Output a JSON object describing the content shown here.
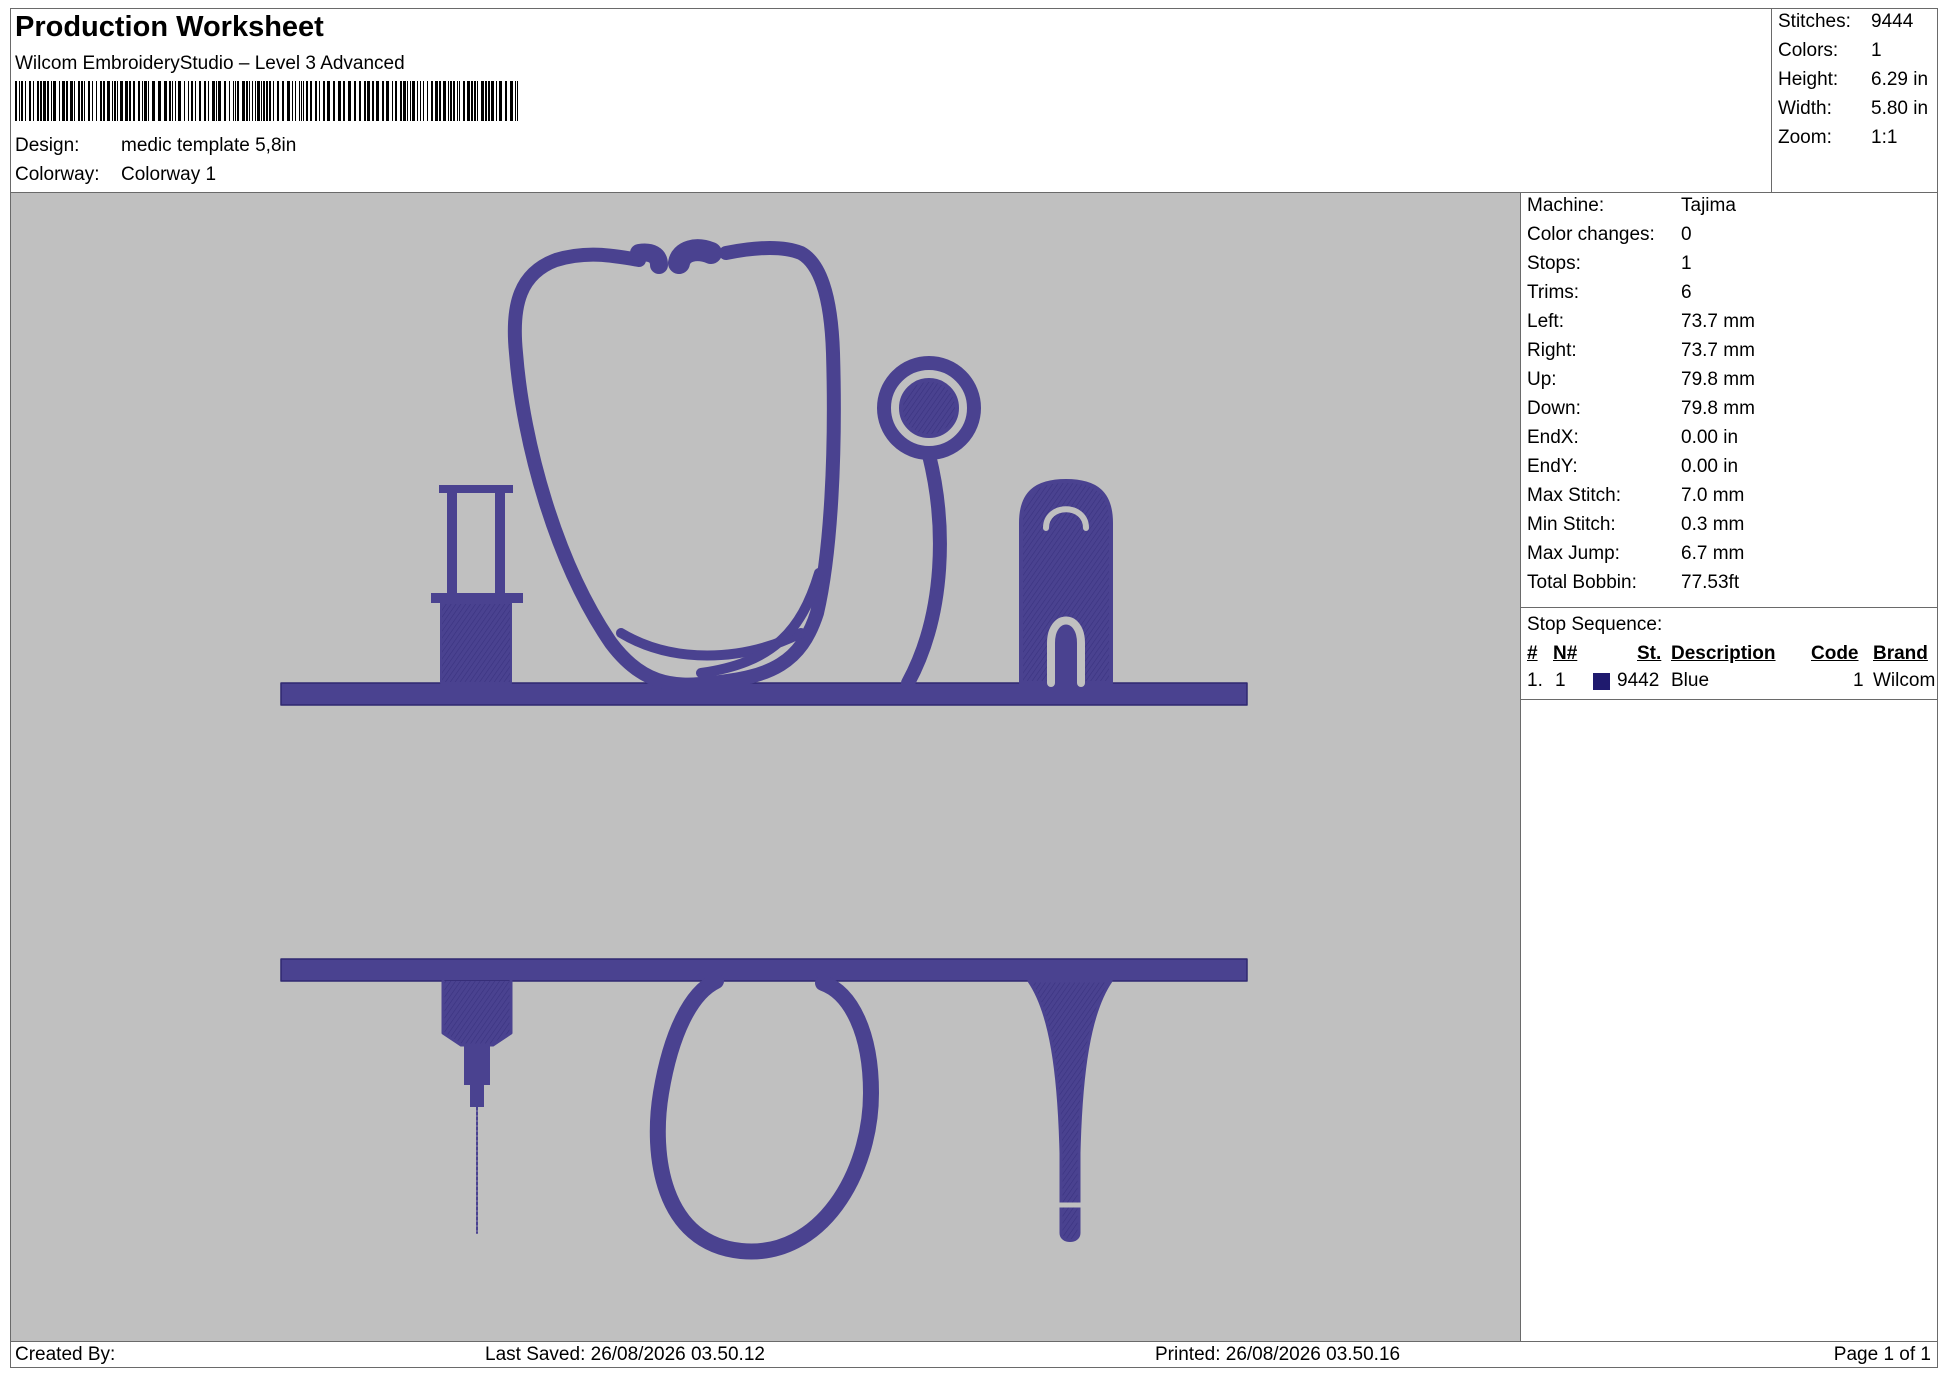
{
  "header": {
    "title": "Production Worksheet",
    "product": "Wilcom EmbroideryStudio – Level 3 Advanced",
    "design_label": "Design:",
    "design_value": "medic template 5,8in",
    "colorway_label": "Colorway:",
    "colorway_value": "Colorway 1"
  },
  "summary": [
    {
      "label": "Stitches:",
      "value": "9444"
    },
    {
      "label": "Colors:",
      "value": "1"
    },
    {
      "label": "Height:",
      "value": "6.29 in"
    },
    {
      "label": "Width:",
      "value": "5.80 in"
    },
    {
      "label": "Zoom:",
      "value": "1:1"
    }
  ],
  "info": [
    {
      "label": "Machine:",
      "value": "Tajima"
    },
    {
      "label": "Color changes:",
      "value": "0"
    },
    {
      "label": "Stops:",
      "value": "1"
    },
    {
      "label": "Trims:",
      "value": "6"
    },
    {
      "label": "Left:",
      "value": "73.7 mm"
    },
    {
      "label": "Right:",
      "value": "73.7 mm"
    },
    {
      "label": "Up:",
      "value": "79.8 mm"
    },
    {
      "label": "Down:",
      "value": "79.8 mm"
    },
    {
      "label": "EndX:",
      "value": "0.00 in"
    },
    {
      "label": "EndY:",
      "value": "0.00 in"
    },
    {
      "label": "Max Stitch:",
      "value": "7.0 mm"
    },
    {
      "label": "Min Stitch:",
      "value": "0.3 mm"
    },
    {
      "label": "Max Jump:",
      "value": "6.7 mm"
    },
    {
      "label": "Total Bobbin:",
      "value": "77.53ft"
    }
  ],
  "stop_sequence": {
    "title": "Stop Sequence:",
    "columns": {
      "num": "#",
      "needle": "N#",
      "stitches": "St.",
      "description": "Description",
      "code": "Code",
      "brand": "Brand"
    },
    "rows": [
      {
        "num": "1.",
        "needle": "1",
        "color": "#1f1a6e",
        "stitches": "9442",
        "description": "Blue",
        "code": "1",
        "brand": "Wilcom"
      }
    ]
  },
  "footer": {
    "created": "Created By:",
    "saved": "Last Saved: 26/08/2026 03.50.12",
    "printed": "Printed: 26/08/2026 03.50.16",
    "page": "Page 1 of 1"
  },
  "colors": {
    "thread": "#4a4290",
    "thread_dark": "#2f2870",
    "background": "#c0c0c0"
  }
}
